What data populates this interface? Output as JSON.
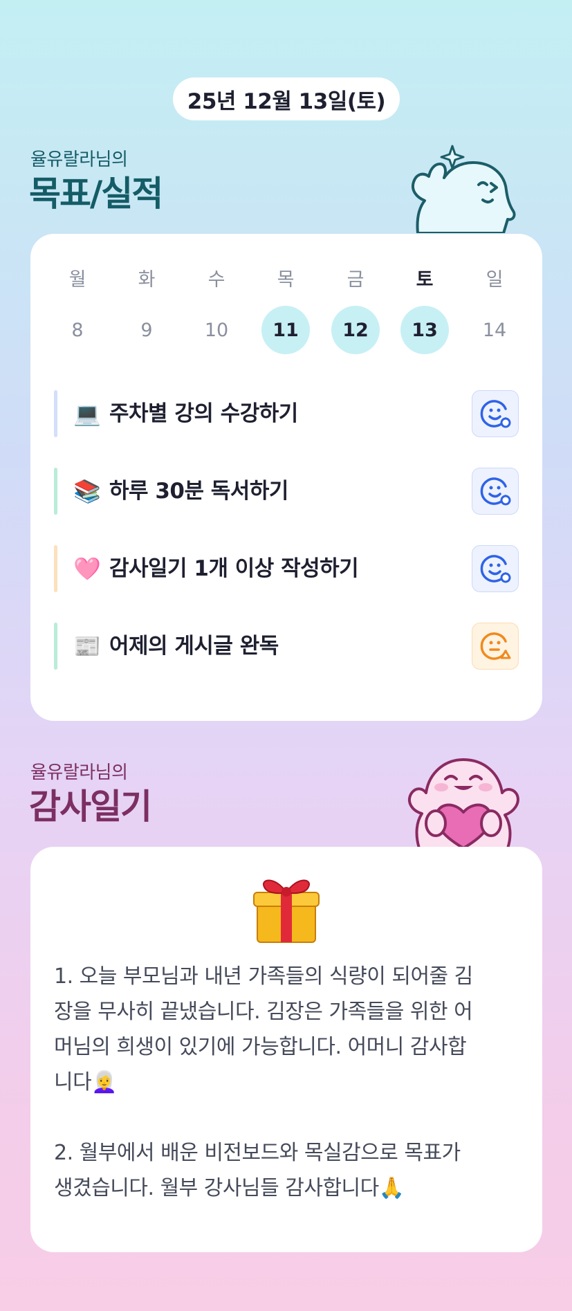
{
  "header": {
    "date": "25년 12월 13일(토)"
  },
  "goals_section": {
    "owner_label": "율유랄라님의",
    "title": "목표/실적"
  },
  "calendar": {
    "days": [
      {
        "weekday": "월",
        "date": "8",
        "bold": false,
        "highlight": false
      },
      {
        "weekday": "화",
        "date": "9",
        "bold": false,
        "highlight": false
      },
      {
        "weekday": "수",
        "date": "10",
        "bold": false,
        "highlight": false
      },
      {
        "weekday": "목",
        "date": "11",
        "bold": false,
        "highlight": true
      },
      {
        "weekday": "금",
        "date": "12",
        "bold": false,
        "highlight": true
      },
      {
        "weekday": "토",
        "date": "13",
        "bold": true,
        "highlight": true
      },
      {
        "weekday": "일",
        "date": "14",
        "bold": false,
        "highlight": false
      }
    ],
    "highlight_color": "#c7f0f5"
  },
  "goals": [
    {
      "icon": "💻",
      "text": "주차별 강의 수강하기",
      "bar_color": "#d4dffb",
      "status": "done-smile-icon",
      "status_color": "#2f63e6"
    },
    {
      "icon": "📚",
      "text": "하루 30분 독서하기",
      "bar_color": "#b9ecd9",
      "status": "done-smile-icon",
      "status_color": "#2f63e6"
    },
    {
      "icon": "🩷",
      "text": "감사일기 1개 이상 작성하기",
      "bar_color": "#fde0bd",
      "status": "done-smile-icon",
      "status_color": "#2f63e6"
    },
    {
      "icon": "📰",
      "text": "어제의 게시글 완독",
      "bar_color": "#b9ecd9",
      "status": "partial-face-icon",
      "status_color": "#f08a1c"
    }
  ],
  "gratitude_section": {
    "owner_label": "율유랄라님의",
    "title": "감사일기"
  },
  "diary": {
    "icon": "gift-icon",
    "entry1_lines": [
      "1. 오늘 부모님과 내년 가족들의 식량이 되어줄 김",
      "장을 무사히 끝냈습니다. 김장은 가족들을 위한 어",
      "머님의 희생이 있기에 가능합니다. 어머니 감사합",
      "니다👩‍🦳"
    ],
    "entry2_lines": [
      "2. 월부에서 배운 비전보드와 목실감으로 목표가",
      "생겼습니다. 월부 강사님들 감사합니다🙏"
    ]
  }
}
